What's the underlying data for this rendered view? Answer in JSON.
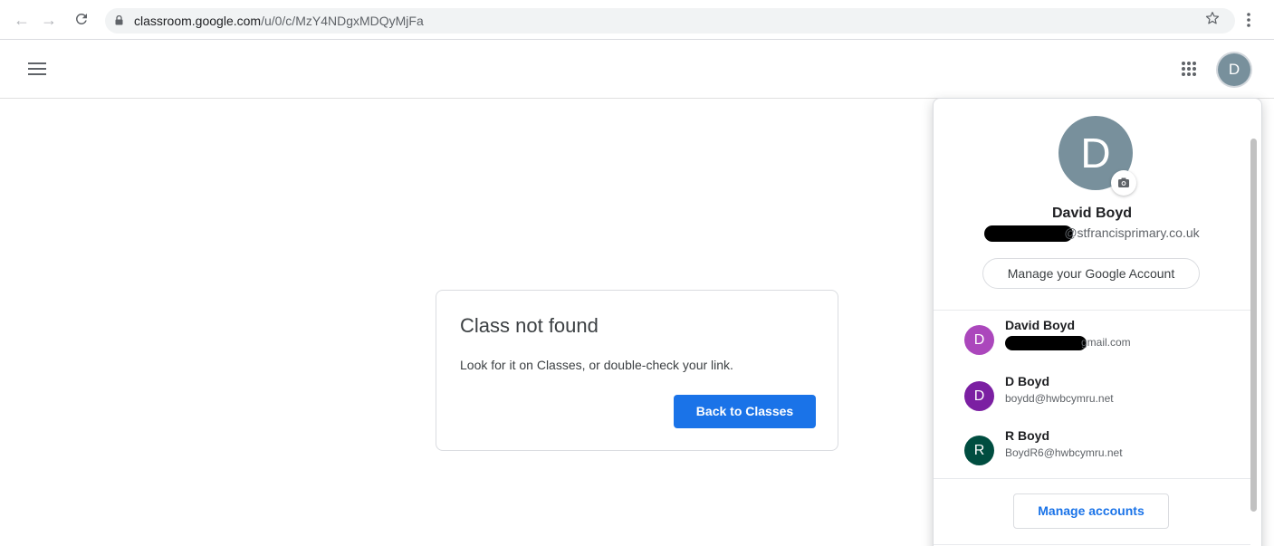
{
  "browser": {
    "url_domain": "classroom.google.com",
    "url_path": "/u/0/c/MzY4NDgxMDQyMjFa"
  },
  "header": {
    "avatar_initial": "D"
  },
  "error_card": {
    "title": "Class not found",
    "message": "Look for it on Classes, or double-check your link.",
    "button_label": "Back to Classes"
  },
  "account_panel": {
    "avatar_initial": "D",
    "name": "David Boyd",
    "email_suffix": "@stfrancisprimary.co.uk",
    "manage_google_label": "Manage your Google Account",
    "accounts": [
      {
        "initial": "D",
        "name": "David Boyd",
        "email": "gmail.com",
        "color": "#ab47bc"
      },
      {
        "initial": "D",
        "name": "D Boyd",
        "email": "boydd@hwbcymru.net",
        "color": "#7b1fa2"
      },
      {
        "initial": "R",
        "name": "R Boyd",
        "email": "BoydR6@hwbcymru.net",
        "color": "#004d40"
      }
    ],
    "manage_accounts_label": "Manage accounts"
  },
  "colors": {
    "accent": "#1a73e8",
    "avatar_primary": "#78909c"
  }
}
